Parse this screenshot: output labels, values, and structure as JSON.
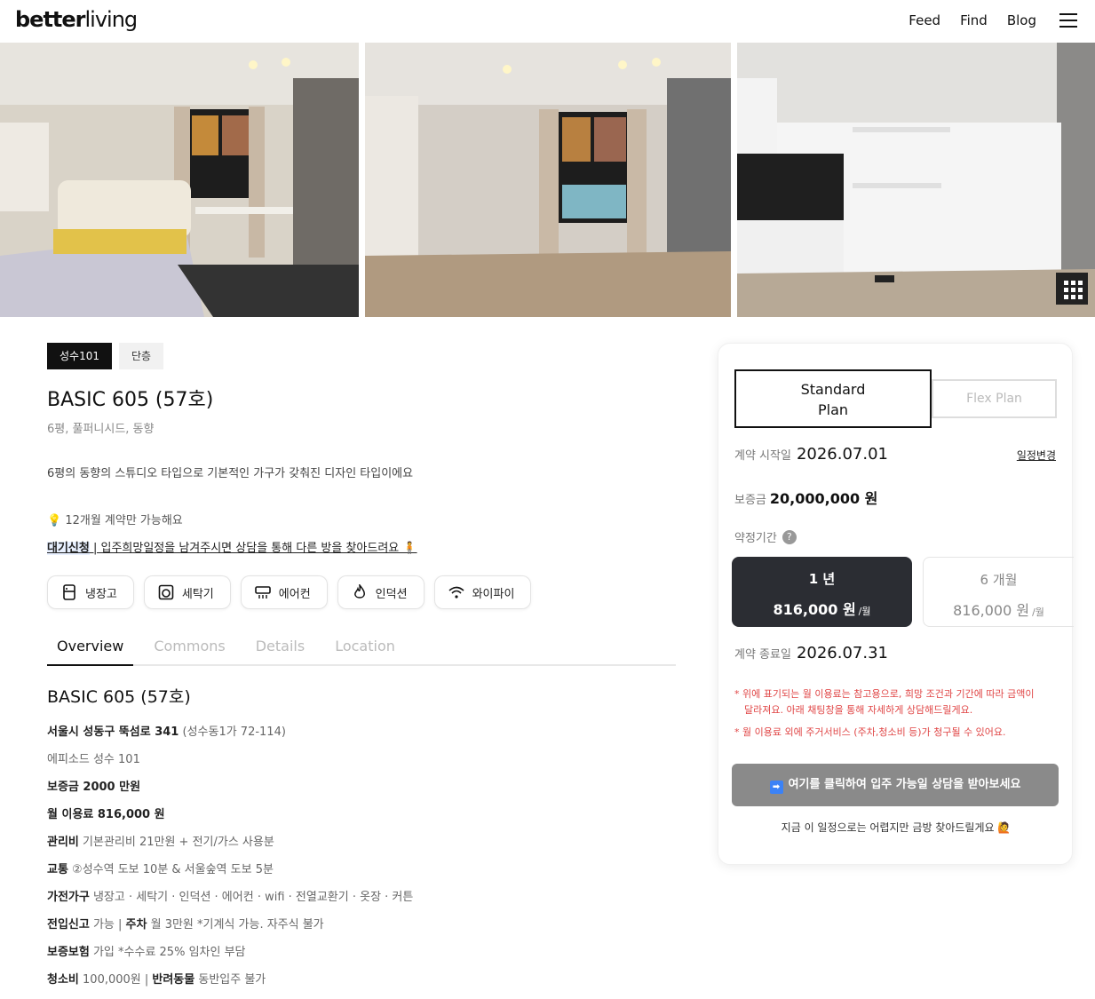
{
  "header": {
    "logo_bold": "better",
    "logo_light": "living",
    "nav": [
      "Feed",
      "Find",
      "Blog"
    ]
  },
  "listing": {
    "tags": [
      "성수101",
      "단층"
    ],
    "title": "BASIC 605 (57호)",
    "subtitle": "6평, 풀퍼니시드, 동향",
    "description": "6평의 동향의 스튜디오 타입으로 기본적인 가구가 갖춰진 디자인 타입이에요",
    "note_icon": "lightbulb-icon",
    "note": "💡 12개월 계약만 가능해요",
    "waitlist_bold": "대기신청",
    "waitlist_text": " | 입주희망일정을 남겨주시면 상담을 통해 다른 방을 찾아드려요 🧍",
    "amenities": [
      {
        "icon": "fridge-icon",
        "label": "냉장고"
      },
      {
        "icon": "washer-icon",
        "label": "세탁기"
      },
      {
        "icon": "aircon-icon",
        "label": "에어컨"
      },
      {
        "icon": "induction-icon",
        "label": "인덕션"
      },
      {
        "icon": "wifi-icon",
        "label": "와이파이"
      }
    ],
    "tabs": [
      "Overview",
      "Commons",
      "Details",
      "Location"
    ],
    "active_tab": "Overview"
  },
  "details": {
    "title": "BASIC 605 (57호)",
    "rows": [
      {
        "bold": "서울시 성동구 뚝섬로 341",
        "text": " (성수동1가 72-114)"
      },
      {
        "bold": "",
        "text": "에피소드 성수 101"
      },
      {
        "bold": "보증금 2000 만원",
        "text": ""
      },
      {
        "bold": "월 이용료 816,000 원",
        "text": ""
      },
      {
        "bold": "관리비",
        "text": " 기본관리비 21만원 + 전기/가스 사용분"
      },
      {
        "bold": "교통",
        "text": " ②성수역 도보 10분 & 서울숲역 도보 5분"
      },
      {
        "bold": "가전가구",
        "text": " 냉장고 · 세탁기 · 인덕션 · 에어컨 · wifi · 전열교환기 · 옷장 · 커튼"
      },
      {
        "bold": "전입신고",
        "text": " 가능 | ",
        "bold2": "주차",
        "text2": " 월 3만원 *기계식 가능. 자주식 불가"
      },
      {
        "bold": "보증보험",
        "text": " 가입 *수수료 25% 임차인 부담"
      },
      {
        "bold": "청소비",
        "text": " 100,000원 | ",
        "bold2": "반려동물",
        "text2": " 동반입주 불가"
      }
    ]
  },
  "booking": {
    "plan_standard": "Standard\nPlan",
    "plan_flex": "Flex Plan",
    "start_label": "계약 시작일",
    "start_value": "2026.07.01",
    "change_label": "일정변경",
    "deposit_label": "보증금",
    "deposit_value": "20,000,000 원",
    "term_label": "약정기간",
    "options": [
      {
        "duration": "1 년",
        "price": "816,000 원",
        "unit": "/월"
      },
      {
        "duration": "6 개월",
        "price": "816,000 원",
        "unit": "/월"
      }
    ],
    "end_label": "계약 종료일",
    "end_value": "2026.07.31",
    "notices": [
      "* 위에 표기되는 월 이용료는 참고용으로, 희망 조건과 기간에 따라 금액이 달라져요. 아래 채팅창을 통해 자세하게 상담해드릴게요.",
      "* 월 이용료 외에 주거서비스 (주차,청소비 등)가 청구될 수 있어요."
    ],
    "cta_icon": "arrow-right-icon",
    "cta": "여기를 클릭하여 입주 가능일 상담을 받아보세요",
    "footnote": "지금 이 일정으로는 어렵지만 금방 찾아드릴게요 🙋"
  },
  "colors": {
    "selected_option": "#2b2d33",
    "cta_bg": "#8a8a8a",
    "notice": "#e04646"
  }
}
